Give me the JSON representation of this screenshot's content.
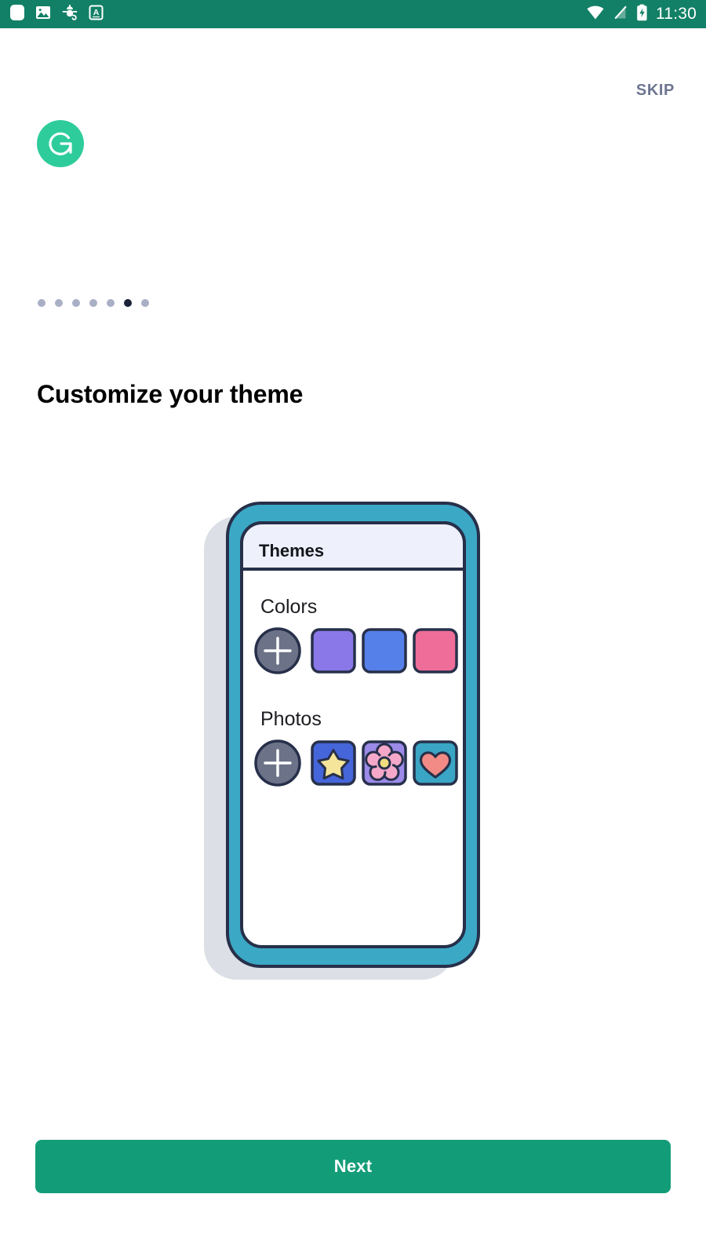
{
  "status_bar": {
    "background": "#128066",
    "time": "11:30",
    "left_icons": [
      {
        "name": "rounded-square-icon",
        "label": "app"
      },
      {
        "name": "image-icon",
        "label": "screenshot"
      },
      {
        "name": "bug-icon",
        "label": "debug"
      },
      {
        "name": "letter-a-icon",
        "label": "keyboard"
      }
    ],
    "right_icons": [
      {
        "name": "wifi-icon",
        "label": "wifi"
      },
      {
        "name": "signal-off-icon",
        "label": "no-signal"
      },
      {
        "name": "battery-charging-icon",
        "label": "charging"
      }
    ]
  },
  "header": {
    "skip_label": "SKIP",
    "skip_color": "#6d7591",
    "logo": {
      "name": "gratitude-logo",
      "glyph": "G",
      "background": "#2ecc9b",
      "foreground": "#ffffff"
    }
  },
  "pager": {
    "total": 7,
    "active_index": 5,
    "inactive_color": "#a9b0c6",
    "active_color": "#1b2238"
  },
  "main": {
    "title": "Customize your theme",
    "illustration": {
      "name": "themes-phone-illustration",
      "frame_color": "#3ba8c6",
      "outline_color": "#27304a",
      "shadow_color": "#dcdfe5",
      "screen_background": "#ffffff",
      "appbar": {
        "title": "Themes",
        "background": "#eef1fb"
      },
      "sections": [
        {
          "label": "Colors",
          "add_button": {
            "name": "add-color-button",
            "shape": "circle",
            "fill": "#6c7288",
            "glyph": "+"
          },
          "swatches": [
            {
              "name": "color-swatch-purple",
              "color": "#8b78e8"
            },
            {
              "name": "color-swatch-blue",
              "color": "#5580ea"
            },
            {
              "name": "color-swatch-pink",
              "color": "#ef6e99"
            }
          ]
        },
        {
          "label": "Photos",
          "add_button": {
            "name": "add-photo-button",
            "shape": "circle",
            "fill": "#6c7288",
            "glyph": "+"
          },
          "tiles": [
            {
              "name": "photo-tile-star",
              "background": "#4565da",
              "motif": "star",
              "motif_color": "#f4e59a"
            },
            {
              "name": "photo-tile-flower",
              "background": "#9b8ae8",
              "motif": "flower",
              "motif_color": "#f5a8c9",
              "motif_center": "#f0dd7e"
            },
            {
              "name": "photo-tile-heart",
              "background": "#3aa5c4",
              "motif": "heart",
              "motif_color": "#f28b85"
            }
          ]
        }
      ]
    }
  },
  "footer": {
    "next_label": "Next",
    "next_color": "#139c78"
  }
}
